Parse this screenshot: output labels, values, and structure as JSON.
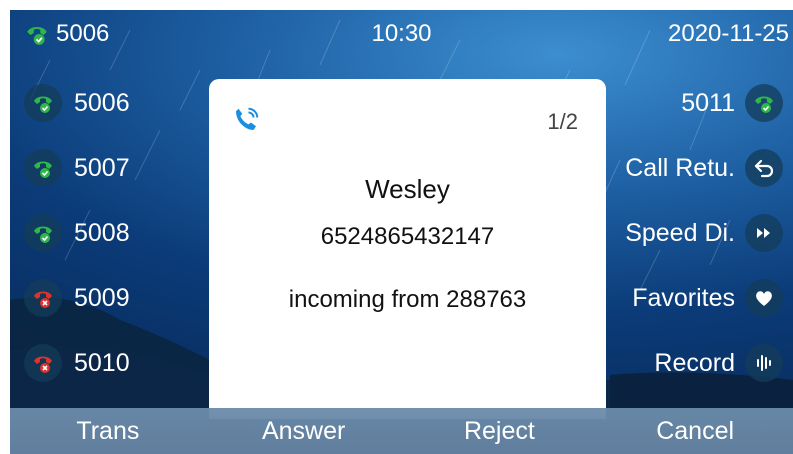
{
  "status": {
    "account": "5006",
    "time": "10:30",
    "date": "2020-11-25"
  },
  "lines_left": [
    {
      "label": "5006",
      "state": "registered"
    },
    {
      "label": "5007",
      "state": "registered"
    },
    {
      "label": "5008",
      "state": "registered"
    },
    {
      "label": "5009",
      "state": "failed"
    },
    {
      "label": "5010",
      "state": "failed"
    }
  ],
  "lines_right": [
    {
      "label": "5011",
      "icon": "phone-registered-icon"
    },
    {
      "label": "Call Retu.",
      "icon": "return-arrow-icon"
    },
    {
      "label": "Speed Di.",
      "icon": "fast-forward-icon"
    },
    {
      "label": "Favorites",
      "icon": "heart-icon"
    },
    {
      "label": "Record",
      "icon": "audio-wave-icon"
    }
  ],
  "dialog": {
    "page": "1/2",
    "name": "Wesley",
    "number": "6524865432147",
    "info": "incoming from 288763"
  },
  "softkeys": [
    "Trans",
    "Answer",
    "Reject",
    "Cancel"
  ],
  "colors": {
    "registered": "#2fb84a",
    "failed": "#e0322c",
    "accent": "#1a8fe0"
  }
}
